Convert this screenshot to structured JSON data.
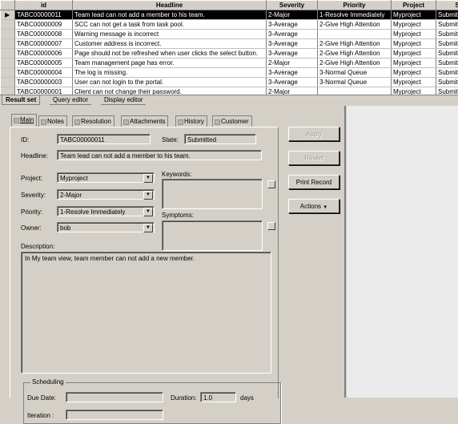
{
  "grid": {
    "columns": [
      "id",
      "Headline",
      "Severity",
      "Priority",
      "Project",
      "St"
    ],
    "rows": [
      {
        "id": "TABC00000011",
        "headline": "Team lead can not add a member to his team.",
        "severity": "2-Major",
        "priority": "1-Resolve Immediately",
        "project": "Myproject",
        "state": "Submit"
      },
      {
        "id": "TABC00000009",
        "headline": "SCC can not get a task from task pool.",
        "severity": "3-Average",
        "priority": "2-Give High Attention",
        "project": "Myproject",
        "state": "Submit"
      },
      {
        "id": "TABC00000008",
        "headline": "Warning message is incorrect",
        "severity": "3-Average",
        "priority": "",
        "project": "Myproject",
        "state": "Submit"
      },
      {
        "id": "TABC00000007",
        "headline": "Customer address is incorrect.",
        "severity": "3-Average",
        "priority": "2-Give High Attention",
        "project": "Myproject",
        "state": "Submit"
      },
      {
        "id": "TABC00000006",
        "headline": "Page should not be refreshed when user clicks the select button.",
        "severity": "3-Average",
        "priority": "2-Give High Attention",
        "project": "Myproject",
        "state": "Submit"
      },
      {
        "id": "TABC00000005",
        "headline": "Team management page has error.",
        "severity": "2-Major",
        "priority": "2-Give High Attention",
        "project": "Myproject",
        "state": "Submit"
      },
      {
        "id": "TABC00000004",
        "headline": "The log is missing.",
        "severity": "3-Average",
        "priority": "3-Normal Queue",
        "project": "Myproject",
        "state": "Submit"
      },
      {
        "id": "TABC00000003",
        "headline": "User can not login to the portal.",
        "severity": "3-Average",
        "priority": "3-Normal Queue",
        "project": "Myproject",
        "state": "Submit"
      },
      {
        "id": "TABC00000001",
        "headline": "Client can not change their password.",
        "severity": "2-Major",
        "priority": "",
        "project": "Myproject",
        "state": "Submit"
      }
    ]
  },
  "bottom_tabs": [
    "Result set",
    "Query editor",
    "Display editor"
  ],
  "form_tabs": [
    "Main",
    "Notes",
    "Resolution",
    "Attachments",
    "History",
    "Customer"
  ],
  "form": {
    "id_label": "ID:",
    "id_value": "TABC00000011",
    "state_label": "State:",
    "state_value": "Submitted",
    "headline_label": "Headline:",
    "headline_value": "Team lead can not add a member to his team.",
    "project_label": "Project:",
    "project_value": "Myproject",
    "severity_label": "Severity:",
    "severity_value": "2-Major",
    "priority_label": "Priority:",
    "priority_value": "1-Resolve Immediately",
    "owner_label": "Owner:",
    "owner_value": "bob",
    "keywords_label": "Keywords:",
    "symptoms_label": "Symptoms:",
    "description_label": "Description:",
    "description_value": "In My team view, team member can not add a new member.",
    "scheduling_title": "Scheduling",
    "due_date_label": "Due Date:",
    "due_date_value": "",
    "duration_label": "Duration:",
    "duration_value": "1.0",
    "duration_unit": "days",
    "iteration_label": "Iteration :",
    "iteration_value": ""
  },
  "actions": {
    "apply": "Apply",
    "revert": "Revert",
    "print": "Print Record",
    "actions": "Actions"
  }
}
